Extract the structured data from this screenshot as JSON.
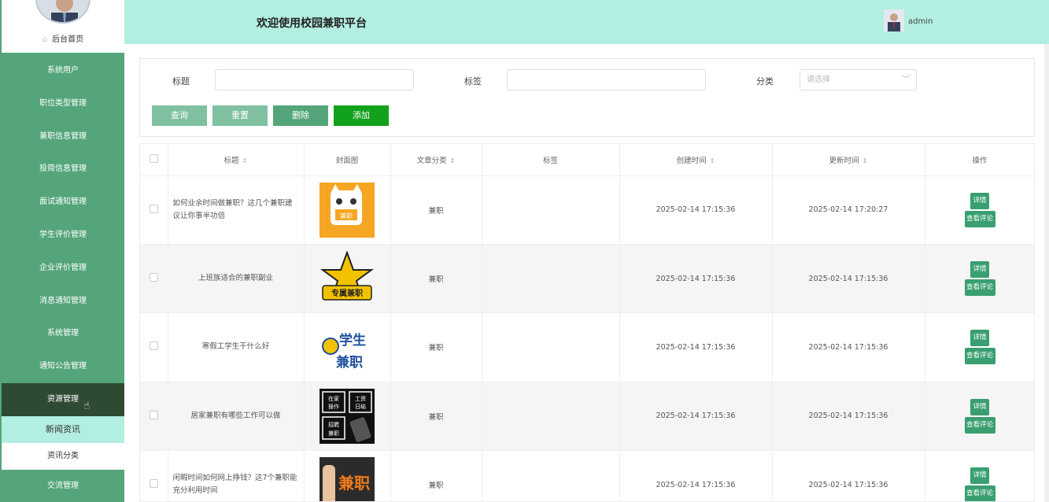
{
  "sidebar": {
    "home_label": "后台首页",
    "menu": [
      {
        "label": "系统用户"
      },
      {
        "label": "职位类型管理"
      },
      {
        "label": "兼职信息管理"
      },
      {
        "label": "投简信息管理"
      },
      {
        "label": "面试通知管理"
      },
      {
        "label": "学生评价管理"
      },
      {
        "label": "企业评价管理"
      },
      {
        "label": "消息通知管理"
      },
      {
        "label": "系统管理"
      },
      {
        "label": "通知公告管理"
      },
      {
        "label": "资源管理"
      }
    ],
    "sub_menu": [
      {
        "label": "新闻资讯"
      },
      {
        "label": "资讯分类"
      }
    ],
    "last_menu": "交流管理"
  },
  "header": {
    "title": "欢迎使用校园兼职平台",
    "username": "admin"
  },
  "search": {
    "title_label": "标题",
    "tag_label": "标签",
    "category_label": "分类",
    "category_placeholder": "请选择",
    "buttons": {
      "query": "查询",
      "reset": "重置",
      "delete": "删除",
      "add": "添加"
    }
  },
  "table": {
    "headers": {
      "title": "标题",
      "cover": "封面图",
      "category": "文章分类",
      "tags": "标签",
      "created": "创建时间",
      "updated": "更新时间",
      "actions": "操作"
    },
    "rows": [
      {
        "title": "如何业余时间做兼职？这几个兼职建议让你事半功倍",
        "category": "兼职",
        "tags": "",
        "created": "2025-02-14 17:15:36",
        "updated": "2025-02-14 17:20:27",
        "cover_text": "兼职"
      },
      {
        "title": "上班族适合的兼职副业",
        "category": "兼职",
        "tags": "",
        "created": "2025-02-14 17:15:36",
        "updated": "2025-02-14 17:15:36",
        "cover_text": "专属兼职"
      },
      {
        "title": "寒假工学生干什么好",
        "category": "兼职",
        "tags": "",
        "created": "2025-02-14 17:15:36",
        "updated": "2025-02-14 17:15:36",
        "cover_text": "学生兼职"
      },
      {
        "title": "居家兼职有哪些工作可以做",
        "category": "兼职",
        "tags": "",
        "created": "2025-02-14 17:15:36",
        "updated": "2025-02-14 17:15:36",
        "cover_text": "在家操作 工资日结 招聘兼职"
      },
      {
        "title": "闲暇时间如何网上挣钱？这7个兼职能充分利用时间",
        "category": "兼职",
        "tags": "",
        "created": "2025-02-14 17:15:36",
        "updated": "2025-02-14 17:15:36",
        "cover_text": "兼职"
      }
    ],
    "action_labels": {
      "detail": "详情",
      "comments": "查看评论"
    }
  },
  "colors": {
    "sidebar": "#54a57a",
    "header": "#b2eee1",
    "active_menu": "#2e4a33",
    "add_button": "#12a11b",
    "action_button": "#3a9f70"
  }
}
